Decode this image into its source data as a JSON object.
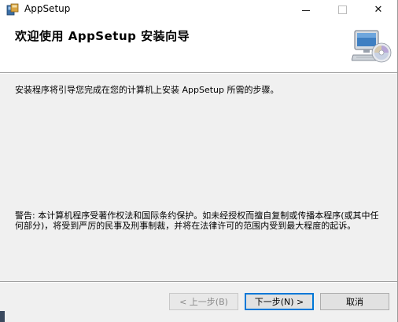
{
  "window": {
    "title": "AppSetup",
    "caption_buttons": {
      "minimize_icon": "minimize-icon",
      "maximize_icon": "maximize-icon",
      "close_icon": "close-icon",
      "close_glyph": "✕"
    }
  },
  "header": {
    "title": "欢迎使用 AppSetup 安装向导",
    "graphic_icon": "setup-computer-cd-icon"
  },
  "body": {
    "intro": "安装程序将引导您完成在您的计算机上安装 AppSetup 所需的步骤。",
    "warning": "警告: 本计算机程序受著作权法和国际条约保护。如未经授权而擅自复制或传播本程序(或其中任何部分)，将受到严厉的民事及刑事制裁，并将在法律许可的范围内受到最大程度的起诉。"
  },
  "buttons": {
    "back": "< 上一步(B)",
    "next": "下一步(N) >",
    "cancel": "取消"
  },
  "colors": {
    "focus_border": "#0078d7",
    "panel_bg": "#f0f0f0",
    "header_bg": "#ffffff"
  }
}
